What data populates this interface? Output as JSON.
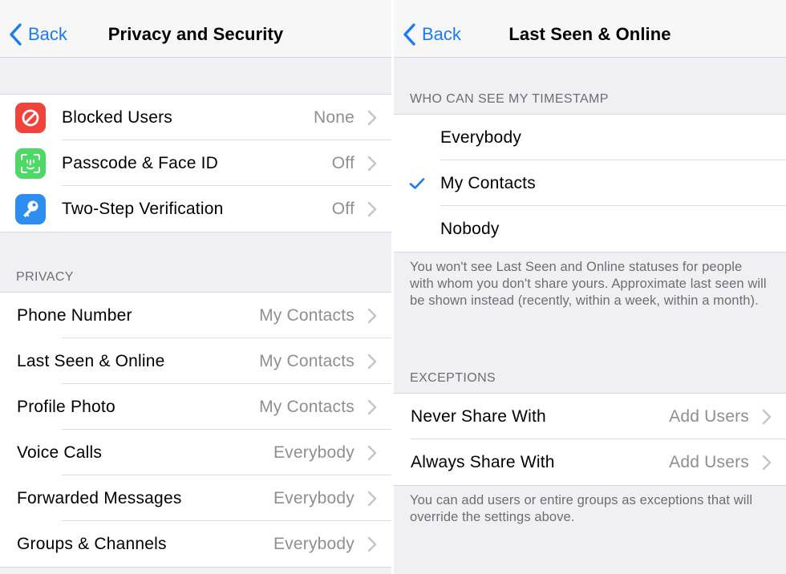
{
  "colors": {
    "accent": "#1a7cf5",
    "blocked_icon": "#f0443a",
    "faceid_icon": "#4cd964",
    "twostep_icon": "#2d8ef0"
  },
  "left": {
    "back_label": "Back",
    "title": "Privacy and Security",
    "security_items": [
      {
        "label": "Blocked Users",
        "value": "None",
        "icon": "blocked-icon"
      },
      {
        "label": "Passcode & Face ID",
        "value": "Off",
        "icon": "face-id-icon"
      },
      {
        "label": "Two-Step Verification",
        "value": "Off",
        "icon": "key-icon"
      }
    ],
    "privacy_header": "PRIVACY",
    "privacy_items": [
      {
        "label": "Phone Number",
        "value": "My Contacts"
      },
      {
        "label": "Last Seen & Online",
        "value": "My Contacts"
      },
      {
        "label": "Profile Photo",
        "value": "My Contacts"
      },
      {
        "label": "Voice Calls",
        "value": "Everybody"
      },
      {
        "label": "Forwarded Messages",
        "value": "Everybody"
      },
      {
        "label": "Groups & Channels",
        "value": "Everybody"
      }
    ]
  },
  "right": {
    "back_label": "Back",
    "title": "Last Seen & Online",
    "timestamp_header": "WHO CAN SEE MY TIMESTAMP",
    "options": [
      {
        "label": "Everybody",
        "selected": false
      },
      {
        "label": "My Contacts",
        "selected": true
      },
      {
        "label": "Nobody",
        "selected": false
      }
    ],
    "timestamp_footer": "You won't see Last Seen and Online statuses for people with whom you don't share yours. Approximate last seen will be shown instead (recently, within a week, within a month).",
    "exceptions_header": "EXCEPTIONS",
    "exceptions": [
      {
        "label": "Never Share With",
        "value": "Add Users"
      },
      {
        "label": "Always Share With",
        "value": "Add Users"
      }
    ],
    "exceptions_footer": "You can add users or entire groups as exceptions that will override the settings above."
  }
}
